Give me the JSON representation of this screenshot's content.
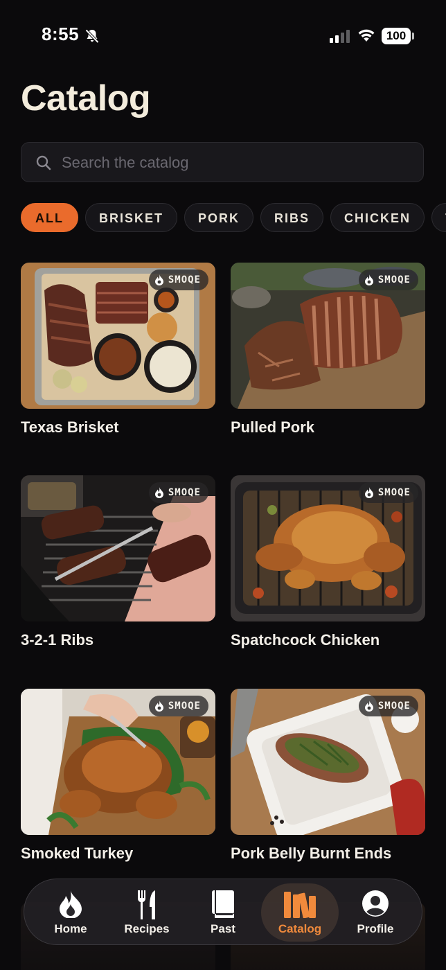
{
  "status_bar": {
    "time": "8:55",
    "battery": "100"
  },
  "page": {
    "title": "Catalog"
  },
  "search": {
    "placeholder": "Search the catalog",
    "value": ""
  },
  "filters": {
    "chips": [
      "ALL",
      "BRISKET",
      "PORK",
      "RIBS",
      "CHICKEN",
      "T"
    ],
    "selected": "ALL"
  },
  "badge_label": "SMOQE",
  "recipes": [
    {
      "title": "Texas Brisket",
      "badge": "SMOQE"
    },
    {
      "title": "Pulled Pork",
      "badge": "SMOQE"
    },
    {
      "title": "3-2-1 Ribs",
      "badge": "SMOQE"
    },
    {
      "title": "Spatchcock Chicken",
      "badge": "SMOQE"
    },
    {
      "title": "Smoked Turkey",
      "badge": "SMOQE"
    },
    {
      "title": "Pork Belly Burnt Ends",
      "badge": "SMOQE"
    }
  ],
  "bottom_nav": {
    "items": [
      {
        "label": "Home",
        "icon": "flame-icon"
      },
      {
        "label": "Recipes",
        "icon": "fork-knife-icon"
      },
      {
        "label": "Past",
        "icon": "book-icon"
      },
      {
        "label": "Catalog",
        "icon": "library-icon"
      },
      {
        "label": "Profile",
        "icon": "profile-icon"
      }
    ],
    "active": "Catalog"
  },
  "colors": {
    "accent": "#ea6b2c",
    "background": "#0b0a0c",
    "nav_active_label": "#f08a3c"
  }
}
